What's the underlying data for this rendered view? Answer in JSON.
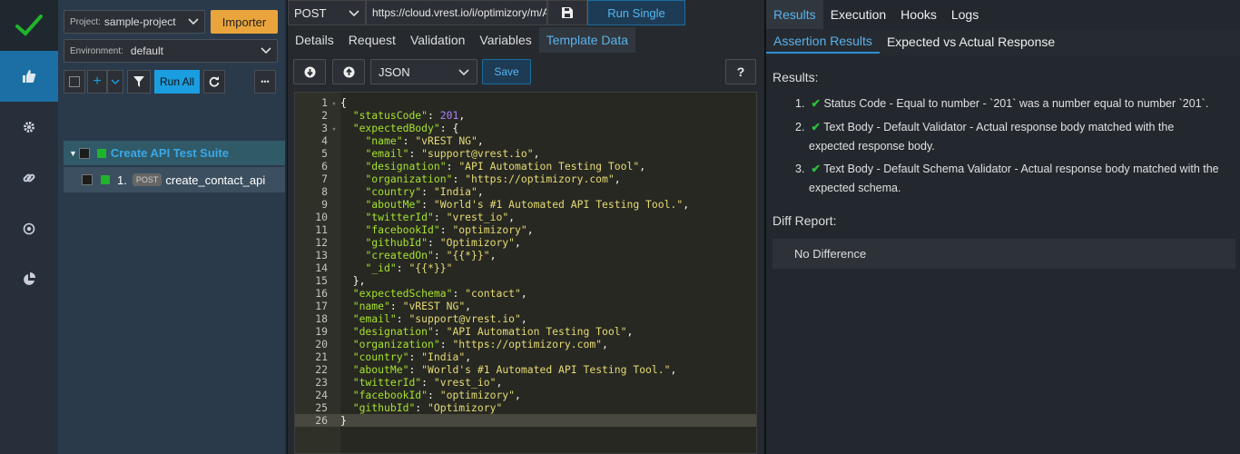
{
  "app": {
    "brand_color": "#1fb42c",
    "accent": "#1a9ee0"
  },
  "rail": {
    "items": [
      "thumbs-up-icon",
      "gear-icon",
      "link-icon",
      "target-icon",
      "pie-chart-icon"
    ]
  },
  "suite_panel": {
    "project_label": "Project:",
    "project_value": "sample-project",
    "importer_label": "Importer",
    "environment_label": "Environment:",
    "environment_value": "default",
    "add_label": "+",
    "run_all_label": "Run All",
    "more_label": "•••",
    "suite_name": "Create API Test Suite",
    "test_index": "1.",
    "test_method": "POST",
    "test_name": "create_contact_api"
  },
  "request": {
    "method": "POST",
    "url": "https://cloud.vrest.io/i/optimizory/m/APIS/contacts",
    "run_single_label": "Run Single",
    "tabs": [
      "Details",
      "Request",
      "Validation",
      "Variables",
      "Template Data"
    ],
    "active_tab": "Template Data",
    "format_value": "JSON",
    "save_label": "Save",
    "help_label": "?"
  },
  "code_lines": [
    "{",
    "  \"statusCode\": 201,",
    "  \"expectedBody\": {",
    "    \"name\": \"vREST NG\",",
    "    \"email\": \"support@vrest.io\",",
    "    \"designation\": \"API Automation Testing Tool\",",
    "    \"organization\": \"https://optimizory.com\",",
    "    \"country\": \"India\",",
    "    \"aboutMe\": \"World's #1 Automated API Testing Tool.\",",
    "    \"twitterId\": \"vrest_io\",",
    "    \"facebookId\": \"optimizory\",",
    "    \"githubId\": \"Optimizory\",",
    "    \"createdOn\": \"{{*}}\",",
    "    \"_id\": \"{{*}}\"",
    "  },",
    "  \"expectedSchema\": \"contact\",",
    "  \"name\": \"vREST NG\",",
    "  \"email\": \"support@vrest.io\",",
    "  \"designation\": \"API Automation Testing Tool\",",
    "  \"organization\": \"https://optimizory.com\",",
    "  \"country\": \"India\",",
    "  \"aboutMe\": \"World's #1 Automated API Testing Tool.\",",
    "  \"twitterId\": \"vrest_io\",",
    "  \"facebookId\": \"optimizory\",",
    "  \"githubId\": \"Optimizory\"",
    "}"
  ],
  "results_panel": {
    "tabs": [
      "Results",
      "Execution",
      "Hooks",
      "Logs"
    ],
    "sub_tabs": [
      "Assertion Results",
      "Expected vs Actual Response"
    ],
    "results_heading": "Results:",
    "results": [
      {
        "no": "1.",
        "line1": "Status Code - Equal to number - `201` was a number equal to number `201`.",
        "line2": ""
      },
      {
        "no": "2.",
        "line1": "Text Body - Default Validator - Actual response body matched with the",
        "line2": "expected response body."
      },
      {
        "no": "3.",
        "line1": "Text Body - Default Schema Validator - Actual response body matched with the",
        "line2": "expected schema."
      }
    ],
    "diff_heading": "Diff Report:",
    "diff_value": "No Difference"
  }
}
